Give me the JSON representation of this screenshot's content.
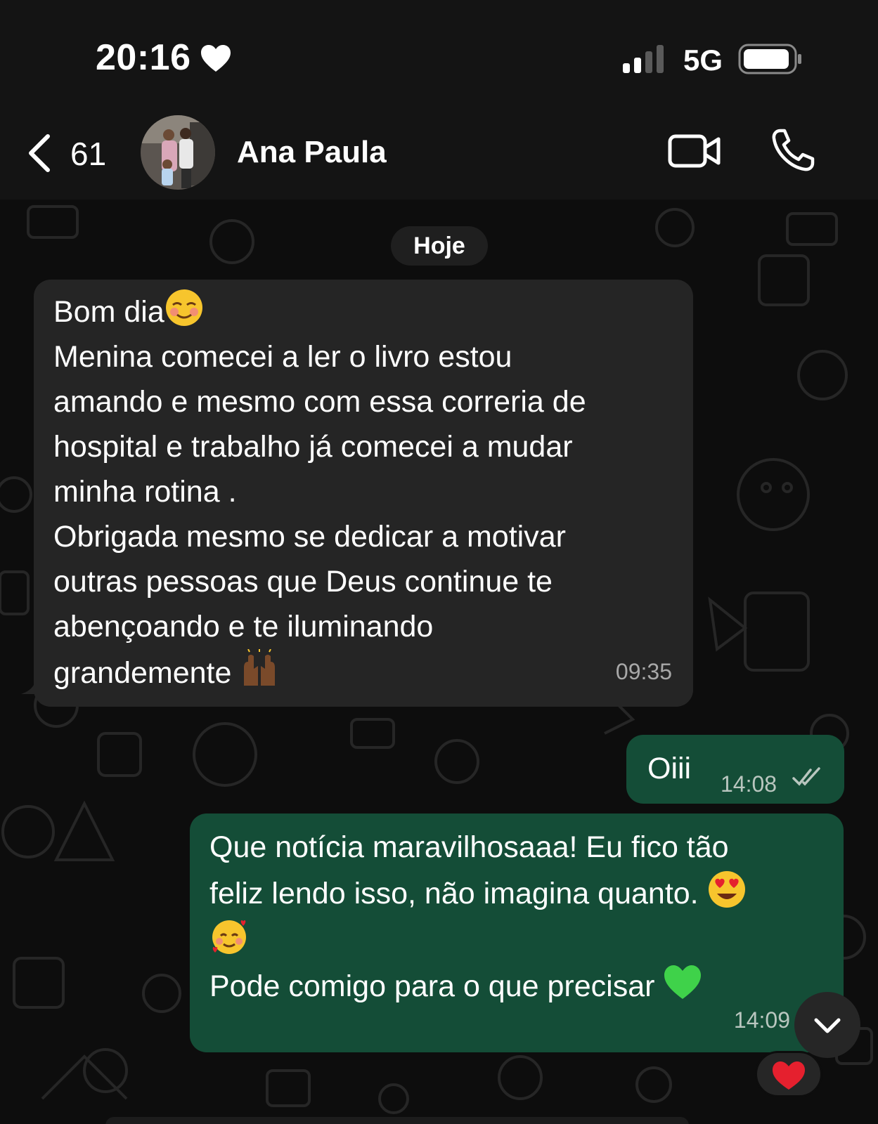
{
  "status_bar": {
    "time": "20:16",
    "network": "5G"
  },
  "header": {
    "unread_count": "61",
    "contact_name": "Ana Paula"
  },
  "chat": {
    "date_label": "Hoje",
    "messages": [
      {
        "direction": "incoming",
        "lines": [
          "Bom dia",
          "Menina comecei a ler o livro estou",
          "amando e mesmo com essa correria de",
          "hospital e trabalho já comecei a mudar",
          "minha rotina .",
          "Obrigada mesmo se dedicar a motivar",
          "outras pessoas que Deus continue te",
          "abençoando e te iluminando",
          "grandemente "
        ],
        "time": "09:35"
      },
      {
        "direction": "outgoing",
        "text": "Oiii",
        "time": "14:08",
        "status": "read"
      },
      {
        "direction": "outgoing",
        "lines": [
          "Que notícia maravilhosaaa! Eu fico tão",
          "feliz lendo isso, não imagina quanto. ",
          "",
          "Pode comigo para o que precisar "
        ],
        "time": "14:09",
        "reaction": "red-heart"
      }
    ]
  },
  "colors": {
    "background": "#0d0d0d",
    "incoming_bubble": "#252525",
    "outgoing_bubble": "#144d37",
    "read_ticks": "#b9c6bf"
  },
  "icons": [
    "heart-icon",
    "signal-icon",
    "battery-icon",
    "back-chevron-icon",
    "video-call-icon",
    "phone-call-icon",
    "double-check-icon",
    "scroll-down-chevron-icon",
    "red-heart-reaction-icon",
    "smiling-blush-emoji",
    "raised-hands-emoji",
    "heart-eyes-emoji",
    "smiling-face-with-hearts-emoji",
    "green-heart-emoji"
  ]
}
